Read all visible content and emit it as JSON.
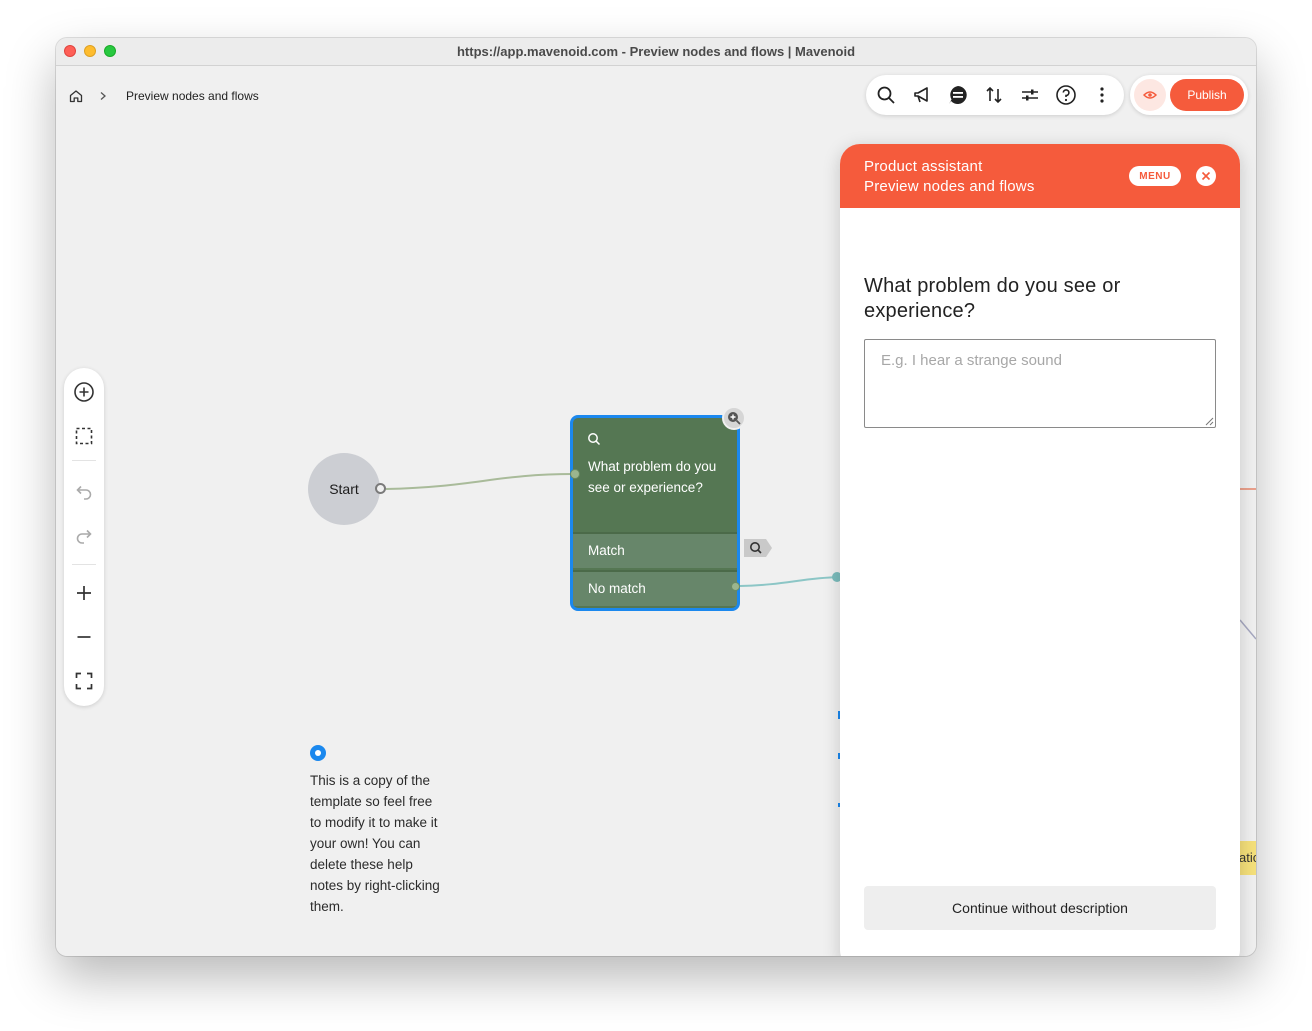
{
  "window": {
    "title": "https://app.mavenoid.com - Preview nodes and flows | Mavenoid"
  },
  "breadcrumb": {
    "home_icon": "home-icon",
    "separator_icon": "chevron-right-icon",
    "current": "Preview nodes and flows"
  },
  "toolbar": {
    "icons": [
      "search-icon",
      "megaphone-icon",
      "chat-icon",
      "sort-icon",
      "sliders-icon",
      "help-icon",
      "more-icon"
    ],
    "preview_icon": "eye-icon",
    "publish_label": "Publish"
  },
  "sidebar": {
    "icons": [
      "add-node-icon",
      "select-area-icon",
      "undo-icon",
      "redo-icon",
      "zoom-in-icon",
      "zoom-out-icon",
      "fit-screen-icon"
    ]
  },
  "flow": {
    "start_label": "Start",
    "question_node": {
      "text": "What problem do you see or experience?",
      "outputs": [
        "Match",
        "No match"
      ]
    },
    "note": {
      "text": "This is a copy of the template so feel free to modify it to make it your own! You can delete these help notes by right-clicking them."
    },
    "partial_node_text": "atic"
  },
  "panel": {
    "title_line1": "Product assistant",
    "title_line2": "Preview nodes and flows",
    "menu_label": "MENU",
    "question": "What problem do you see or experience?",
    "input_placeholder": "E.g. I hear a strange sound",
    "input_value": "",
    "continue_label": "Continue without description"
  },
  "colors": {
    "brand_orange": "#f55b3c",
    "node_green": "#557753",
    "selection_blue": "#1b88ee"
  }
}
